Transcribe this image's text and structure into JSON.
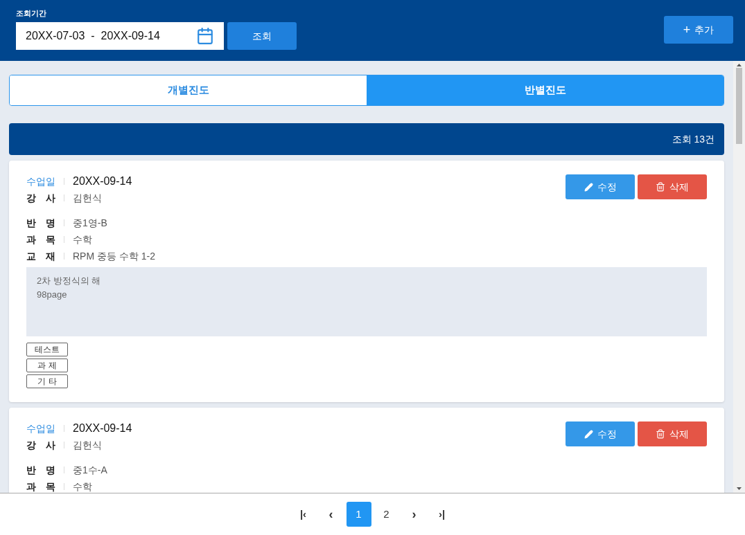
{
  "filter": {
    "label": "조회기간",
    "date_range": "20XX-07-03  -  20XX-09-14",
    "search_button": "조회",
    "add_button": "추가",
    "add_icon": "+"
  },
  "tabs": [
    {
      "label": "개별진도",
      "selected": false
    },
    {
      "label": "반별진도",
      "selected": true
    }
  ],
  "result_bar": {
    "count": "조회 13건"
  },
  "records": [
    {
      "fields": [
        {
          "label": "수업일",
          "value": "20XX-09-14",
          "kind": "date"
        },
        {
          "label": "강 사",
          "value": "김헌식",
          "kind": "plain"
        },
        {
          "label": "반 명",
          "value": "중1영-B",
          "kind": "gap"
        },
        {
          "label": "과 목",
          "value": "수학",
          "kind": "plain"
        },
        {
          "label": "교 재",
          "value": "RPM 중등 수학 1-2",
          "kind": "plain"
        }
      ],
      "memo": [
        "2차 방정식의 해",
        "98page"
      ],
      "tags": [
        "테스트",
        "과 제",
        "기 타"
      ],
      "edit": "수정",
      "delete": "삭제"
    },
    {
      "fields": [
        {
          "label": "수업일",
          "value": "20XX-09-14",
          "kind": "date"
        },
        {
          "label": "강 사",
          "value": "김헌식",
          "kind": "plain"
        },
        {
          "label": "반 명",
          "value": "중1수-A",
          "kind": "gap"
        },
        {
          "label": "과 목",
          "value": "수학",
          "kind": "plain"
        }
      ],
      "edit": "수정",
      "delete": "삭제"
    }
  ],
  "pagination": {
    "first": "|‹",
    "prev": "‹",
    "pages": [
      {
        "label": "1",
        "selected": true
      },
      {
        "label": "2",
        "selected": false
      }
    ],
    "next": "›",
    "last": "›|"
  }
}
